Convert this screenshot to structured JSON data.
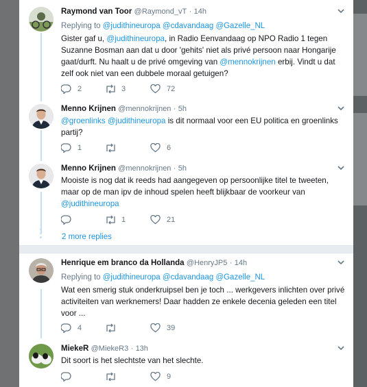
{
  "conversation": [
    {
      "name": "Raymond van Toor",
      "handle": "@Raymond_vT",
      "time": "14h",
      "replying_label": "Replying to",
      "replying_to": [
        "@judithineuropa",
        "@cdavandaag",
        "@Gazelle_NL"
      ],
      "text_segments": [
        {
          "t": "Gister gaf u, "
        },
        {
          "t": "@judithineuropa",
          "link": true
        },
        {
          "t": ", in Radio Eenvandaag op NPO Radio 1 tegen Suzanne Bosman aan dat u door 'gehits' niet als privé persoon naar Hongarije gaat/durft. Nu haalt u de privé omgeving van "
        },
        {
          "t": "@mennokrijnen",
          "link": true
        },
        {
          "t": " erbij. Vindt u dat zelf ook niet van een dubbele moraal getuigen?"
        }
      ],
      "replies": "2",
      "retweets": "3",
      "likes": "72"
    },
    {
      "name": "Menno Krijnen",
      "handle": "@mennokrijnen",
      "time": "5h",
      "text_segments": [
        {
          "t": "@groenlinks",
          "link": true
        },
        {
          "t": " "
        },
        {
          "t": "@judithineuropa",
          "link": true
        },
        {
          "t": " is dit normaal voor een EU politica en groenlinks partij?"
        }
      ],
      "replies": "1",
      "retweets": "",
      "likes": "6"
    },
    {
      "name": "Menno Krijnen",
      "handle": "@mennokrijnen",
      "time": "5h",
      "text_segments": [
        {
          "t": "Mooiste is nog dat ik reeds had aangegeven op persoonlijke titel te tweeten, maar op de man ipv de inhoud spelen heeft blijkbaar de voorkeur van "
        },
        {
          "t": "@judithineuropa",
          "link": true
        }
      ],
      "replies": "",
      "retweets": "1",
      "likes": "21"
    }
  ],
  "more_replies": "2 more replies",
  "second_conversation": [
    {
      "name": "Henrique em branco da Hollanda",
      "handle": "@HenryJP5",
      "time": "14h",
      "replying_label": "Replying to",
      "replying_to": [
        "@judithineuropa",
        "@cdavandaag",
        "@Gazelle_NL"
      ],
      "text_segments": [
        {
          "t": "Wat een smerig stuk onderkruipsel ben je toch ... werkgevers inlichten over privé activiteiten van werknemers!  Daar hadden ze enkele decenia geleden een titel voor ..."
        }
      ],
      "replies": "4",
      "retweets": "",
      "likes": "39"
    },
    {
      "name": "MiekeR",
      "handle": "@MiekeR3",
      "time": "13h",
      "text_segments": [
        {
          "t": "Dit soort is het slechtste van het slechte."
        }
      ],
      "replies": "",
      "retweets": "",
      "likes": "9"
    }
  ],
  "icons": {
    "reply": "reply-icon",
    "retweet": "retweet-icon",
    "like": "heart-icon",
    "caret": "chevron-down-icon"
  },
  "colors": {
    "link": "#1b95e0",
    "secondary": "#657786",
    "thread_line": "#c4dff5"
  }
}
